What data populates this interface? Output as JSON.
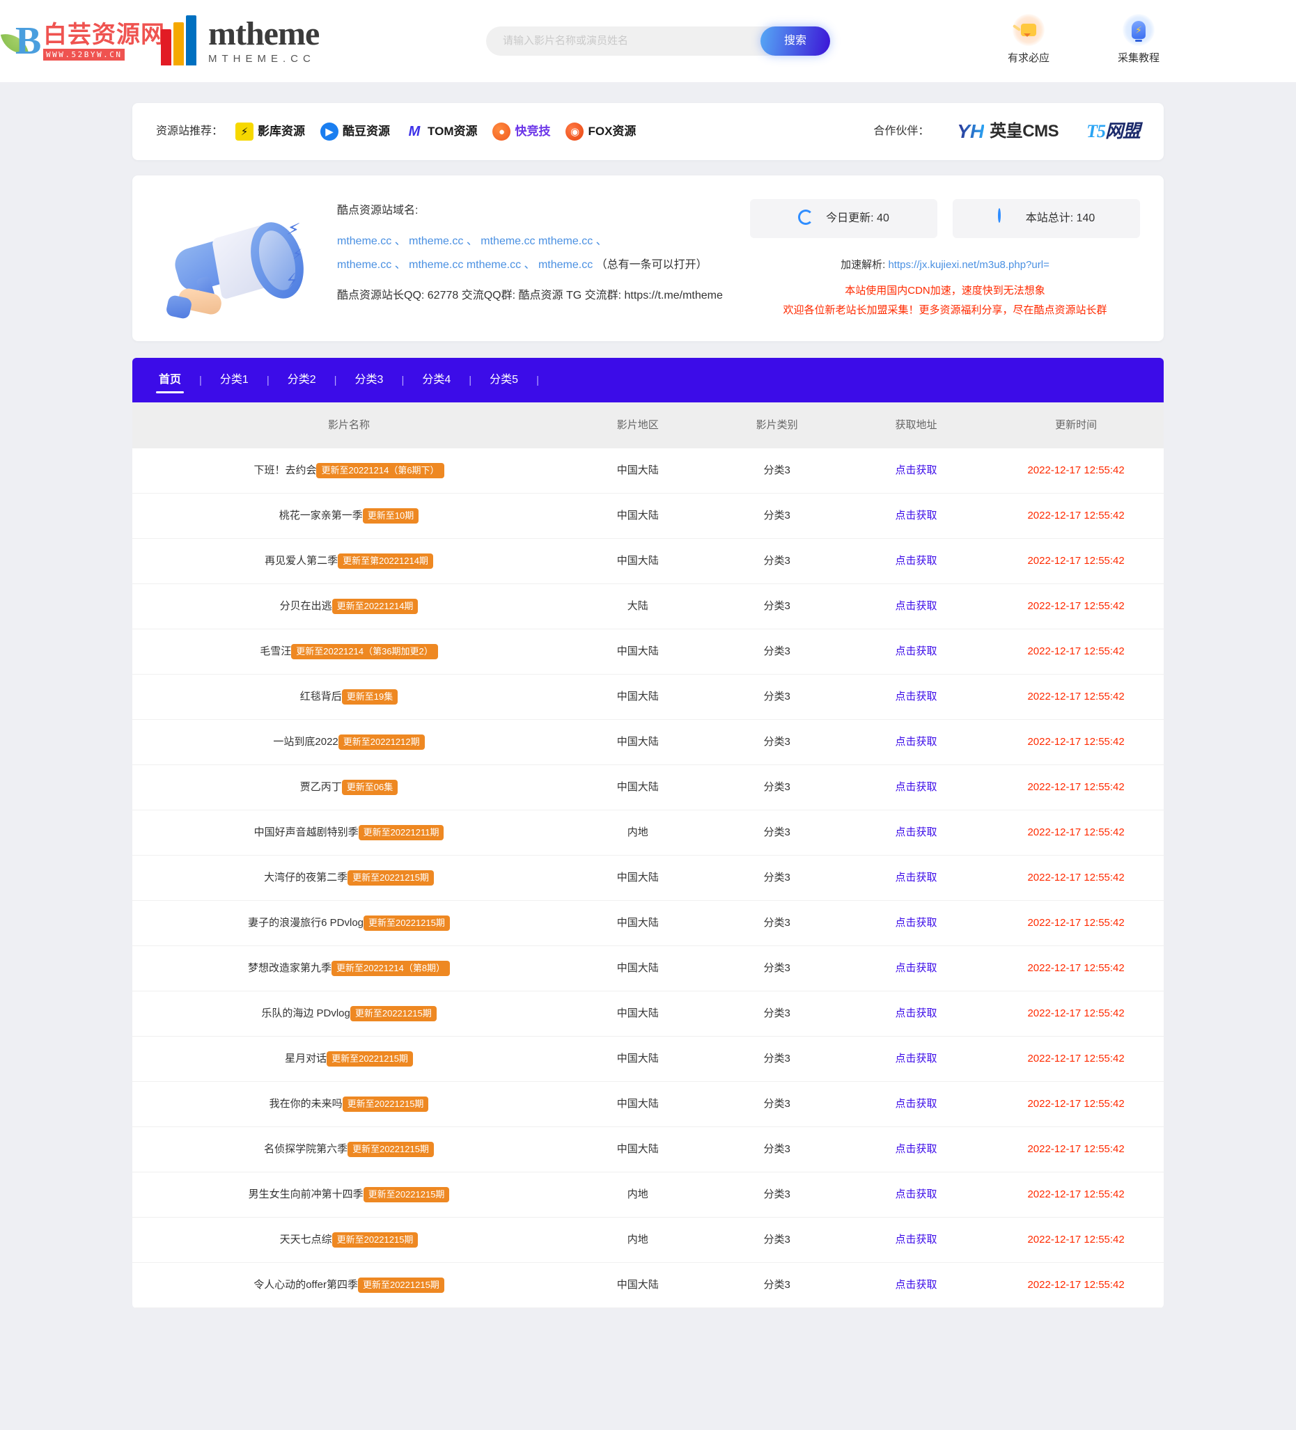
{
  "header": {
    "watermark": {
      "cn": "白芸资源网",
      "url": "WWW.52BYW.CN"
    },
    "logo": {
      "main": "mtheme",
      "sub": "MTHEME.CC"
    },
    "search": {
      "placeholder": "请输入影片名称或演员姓名",
      "value": "",
      "button": "搜索"
    },
    "actions": [
      {
        "label": "有求必应",
        "icon": "speech-bubble-icon"
      },
      {
        "label": "采集教程",
        "icon": "lightbulb-icon"
      }
    ]
  },
  "partners": {
    "recommend_label": "资源站推荐：",
    "sites": [
      {
        "name": "影库资源",
        "mark": "⚡",
        "badge_class": "yellow",
        "ink": "ink-dark"
      },
      {
        "name": "酷豆资源",
        "mark": "▶",
        "badge_class": "blue",
        "ink": "ink-dark"
      },
      {
        "name": "TOM资源",
        "mark": "M",
        "badge_class": "mblue",
        "ink": "ink-dark"
      },
      {
        "name": "快竞技",
        "mark": "●",
        "badge_class": "orange",
        "ink": "ink-violet"
      },
      {
        "name": "FOX资源",
        "mark": "◉",
        "badge_class": "red",
        "ink": "ink-dark"
      }
    ],
    "partner_label": "合作伙伴：",
    "partner_logos": [
      {
        "mark": "YH",
        "text": "英皇CMS"
      },
      {
        "mark": "T5",
        "text": "网盟"
      }
    ]
  },
  "notice": {
    "domain_title": "酷点资源站域名:",
    "domains_line1": "mtheme.cc 、 mtheme.cc 、 mtheme.cc mtheme.cc 、",
    "domains_line2": "mtheme.cc 、 mtheme.cc mtheme.cc 、 mtheme.cc",
    "domains_suffix": "（总有一条可以打开）",
    "contact": "酷点资源站长QQ: 62778 交流QQ群: 酷点资源 TG 交流群: https://t.me/mtheme",
    "stats": [
      {
        "icon": "refresh-icon",
        "label": "今日更新:",
        "value": "40"
      },
      {
        "icon": "pie-chart-icon",
        "label": "本站总计:",
        "value": "140"
      }
    ],
    "parse_label": "加速解析:",
    "parse_url": "https://jx.kujiexi.net/m3u8.php?url=",
    "red_line1": "本站使用国内CDN加速，速度快到无法想象",
    "red_line2": "欢迎各位新老站长加盟采集！更多资源福利分享，尽在酷点资源站长群"
  },
  "nav": {
    "items": [
      {
        "label": "首页",
        "active": true
      },
      {
        "label": "分类1",
        "active": false
      },
      {
        "label": "分类2",
        "active": false
      },
      {
        "label": "分类3",
        "active": false
      },
      {
        "label": "分类4",
        "active": false
      },
      {
        "label": "分类5",
        "active": false
      }
    ],
    "separator": "|"
  },
  "table": {
    "columns": [
      "影片名称",
      "影片地区",
      "影片类别",
      "获取地址",
      "更新时间"
    ],
    "link_label": "点击获取",
    "rows": [
      {
        "title": "下班！去约会",
        "badge": "更新至20221214（第6期下）",
        "area": "中国大陆",
        "category": "分类3",
        "link": "点击获取",
        "time": "2022-12-17 12:55:42"
      },
      {
        "title": "桃花一家亲第一季",
        "badge": "更新至10期",
        "area": "中国大陆",
        "category": "分类3",
        "link": "点击获取",
        "time": "2022-12-17 12:55:42"
      },
      {
        "title": "再见爱人第二季",
        "badge": "更新至第20221214期",
        "area": "中国大陆",
        "category": "分类3",
        "link": "点击获取",
        "time": "2022-12-17 12:55:42"
      },
      {
        "title": "分贝在出逃",
        "badge": "更新至20221214期",
        "area": "大陆",
        "category": "分类3",
        "link": "点击获取",
        "time": "2022-12-17 12:55:42"
      },
      {
        "title": "毛雪汪",
        "badge": "更新至20221214（第36期加更2）",
        "area": "中国大陆",
        "category": "分类3",
        "link": "点击获取",
        "time": "2022-12-17 12:55:42"
      },
      {
        "title": "红毯背后",
        "badge": "更新至19集",
        "area": "中国大陆",
        "category": "分类3",
        "link": "点击获取",
        "time": "2022-12-17 12:55:42"
      },
      {
        "title": "一站到底2022",
        "badge": "更新至20221212期",
        "area": "中国大陆",
        "category": "分类3",
        "link": "点击获取",
        "time": "2022-12-17 12:55:42"
      },
      {
        "title": "贾乙丙丁",
        "badge": "更新至06集",
        "area": "中国大陆",
        "category": "分类3",
        "link": "点击获取",
        "time": "2022-12-17 12:55:42"
      },
      {
        "title": "中国好声音越剧特别季",
        "badge": "更新至20221211期",
        "area": "内地",
        "category": "分类3",
        "link": "点击获取",
        "time": "2022-12-17 12:55:42"
      },
      {
        "title": "大湾仔的夜第二季",
        "badge": "更新至20221215期",
        "area": "中国大陆",
        "category": "分类3",
        "link": "点击获取",
        "time": "2022-12-17 12:55:42"
      },
      {
        "title": "妻子的浪漫旅行6 PDvlog",
        "badge": "更新至20221215期",
        "area": "中国大陆",
        "category": "分类3",
        "link": "点击获取",
        "time": "2022-12-17 12:55:42"
      },
      {
        "title": "梦想改造家第九季",
        "badge": "更新至20221214（第8期）",
        "area": "中国大陆",
        "category": "分类3",
        "link": "点击获取",
        "time": "2022-12-17 12:55:42"
      },
      {
        "title": "乐队的海边 PDvlog",
        "badge": "更新至20221215期",
        "area": "中国大陆",
        "category": "分类3",
        "link": "点击获取",
        "time": "2022-12-17 12:55:42"
      },
      {
        "title": "星月对话",
        "badge": "更新至20221215期",
        "area": "中国大陆",
        "category": "分类3",
        "link": "点击获取",
        "time": "2022-12-17 12:55:42"
      },
      {
        "title": "我在你的未来吗",
        "badge": "更新至20221215期",
        "area": "中国大陆",
        "category": "分类3",
        "link": "点击获取",
        "time": "2022-12-17 12:55:42"
      },
      {
        "title": "名侦探学院第六季",
        "badge": "更新至20221215期",
        "area": "中国大陆",
        "category": "分类3",
        "link": "点击获取",
        "time": "2022-12-17 12:55:42"
      },
      {
        "title": "男生女生向前冲第十四季",
        "badge": "更新至20221215期",
        "area": "内地",
        "category": "分类3",
        "link": "点击获取",
        "time": "2022-12-17 12:55:42"
      },
      {
        "title": "天天七点综",
        "badge": "更新至20221215期",
        "area": "内地",
        "category": "分类3",
        "link": "点击获取",
        "time": "2022-12-17 12:55:42"
      },
      {
        "title": "令人心动的offer第四季",
        "badge": "更新至20221215期",
        "area": "中国大陆",
        "category": "分类3",
        "link": "点击获取",
        "time": "2022-12-17 12:55:42"
      }
    ]
  },
  "colors": {
    "nav_bg": "#3c0ce8",
    "badge": "#ee8822",
    "time": "#ff2a00",
    "link": "#3c0ce8",
    "page_bg": "#eeeff3"
  }
}
